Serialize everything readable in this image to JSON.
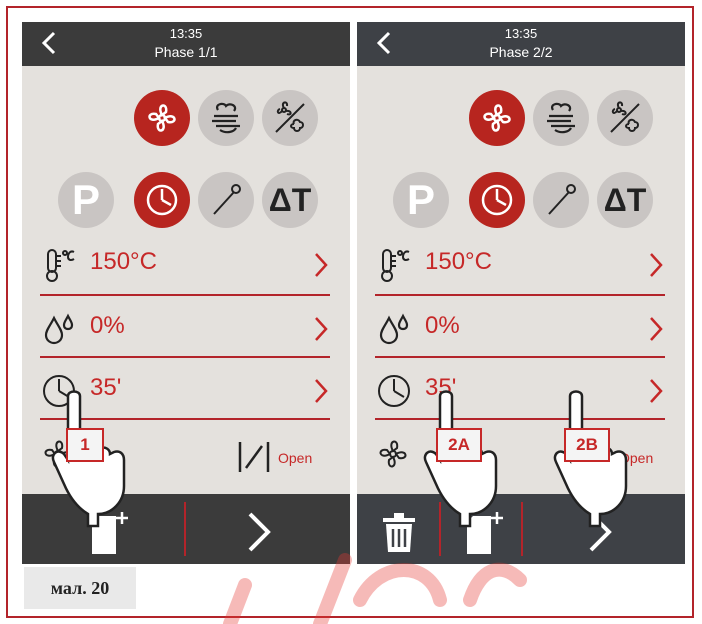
{
  "figure_label": "мал. 20",
  "panels": [
    {
      "time": "13:35",
      "phase": "Phase 1/1",
      "temperature": "150°C",
      "humidity": "0%",
      "time_value": "35'",
      "vent_label": "Open",
      "callouts": [
        "1"
      ]
    },
    {
      "time": "13:35",
      "phase": "Phase 2/2",
      "temperature": "150°C",
      "humidity": "0%",
      "time_value": "35'",
      "vent_label": "Open",
      "callouts": [
        "2A",
        "2B"
      ]
    }
  ],
  "icons": {
    "mode_row": [
      "fan-icon",
      "steam-icon",
      "fan-steam-off-icon"
    ],
    "control_row": [
      "program-icon",
      "timer-icon",
      "probe-icon",
      "delta-t-icon"
    ],
    "bottom_bar": [
      "trash-icon",
      "add-phase-icon",
      "next-icon"
    ]
  },
  "program_letter": "P",
  "delta_t_label": "ΔT",
  "colors": {
    "accent": "#b7251f",
    "header": "#3b3b3b",
    "panel_bg": "#e4e1dd"
  }
}
